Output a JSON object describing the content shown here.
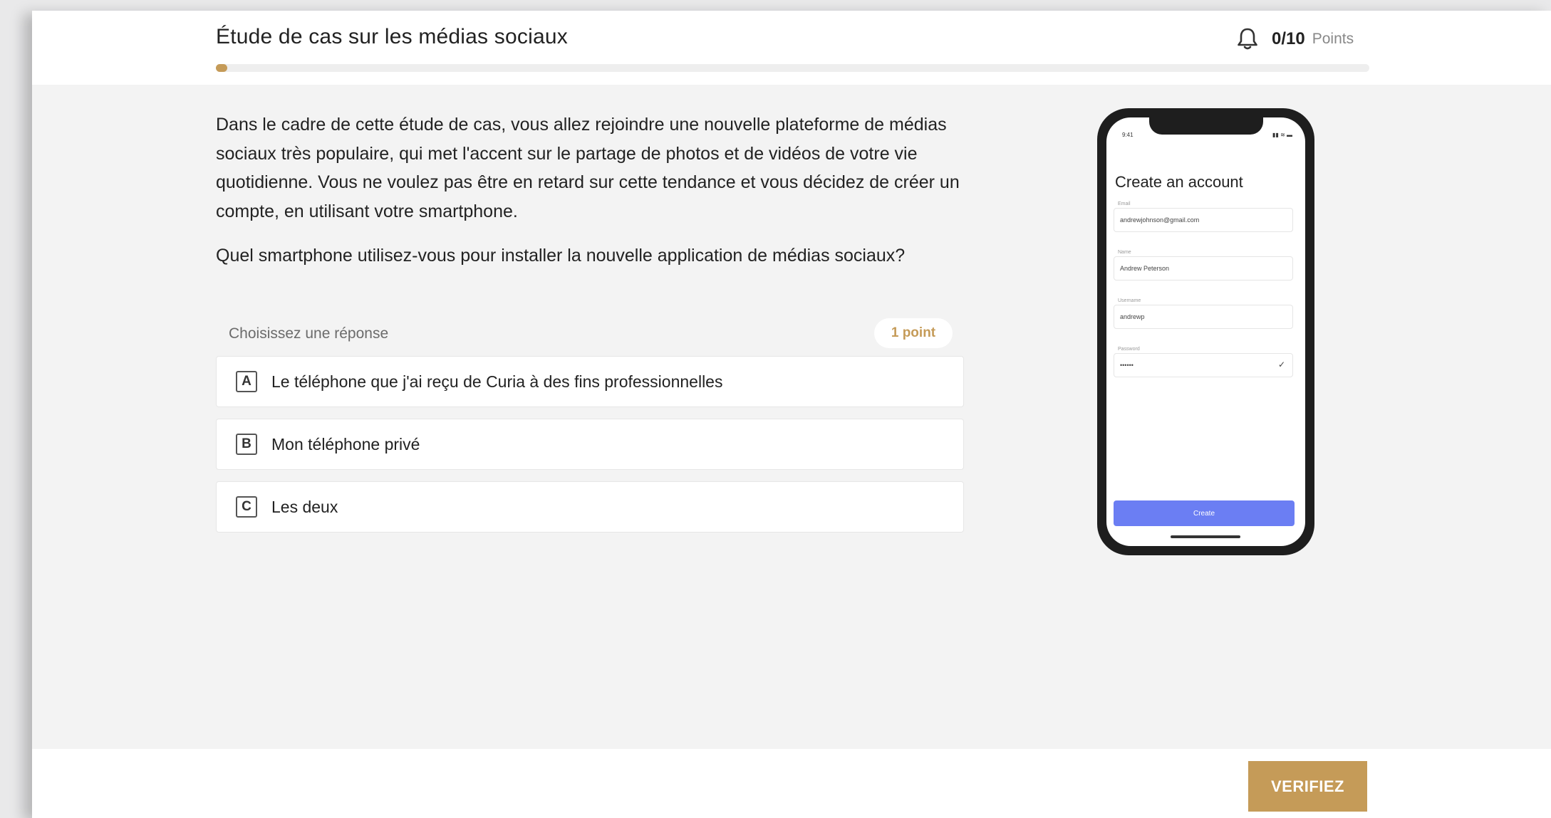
{
  "header": {
    "title": "Étude de cas sur les médias sociaux",
    "points_value": "0/10",
    "points_label": "Points",
    "progress_percent": 1
  },
  "intro": {
    "paragraph": "Dans le cadre de cette étude de cas, vous allez rejoindre une nouvelle plateforme de médias sociaux très populaire, qui met l'accent sur le partage de photos et de vidéos de votre vie quotidienne. Vous ne voulez pas être en retard sur cette tendance et vous décidez de créer un compte, en utilisant votre smartphone.",
    "question": "Quel smartphone utilisez-vous pour installer la nouvelle application de médias sociaux?"
  },
  "answers": {
    "choose_label": "Choisissez une réponse",
    "point_badge": "1 point",
    "options": [
      {
        "letter": "A",
        "text": "Le téléphone que j'ai reçu de Curia à des fins professionnelles"
      },
      {
        "letter": "B",
        "text": "Mon téléphone privé"
      },
      {
        "letter": "C",
        "text": "Les deux"
      }
    ]
  },
  "phone": {
    "time": "9:41",
    "status_icons": "▮▮ ≋ ▬",
    "title": "Create an account",
    "fields": [
      {
        "label": "Email",
        "value": "andrewjohnson@gmail.com"
      },
      {
        "label": "Name",
        "value": "Andrew Peterson"
      },
      {
        "label": "Username",
        "value": "andrewp"
      },
      {
        "label": "Password",
        "value": "••••••"
      }
    ],
    "create_label": "Create"
  },
  "footer": {
    "verify_label": "VERIFIEZ"
  },
  "colors": {
    "accent": "#c59b58",
    "phone_button": "#6b7ef3"
  }
}
